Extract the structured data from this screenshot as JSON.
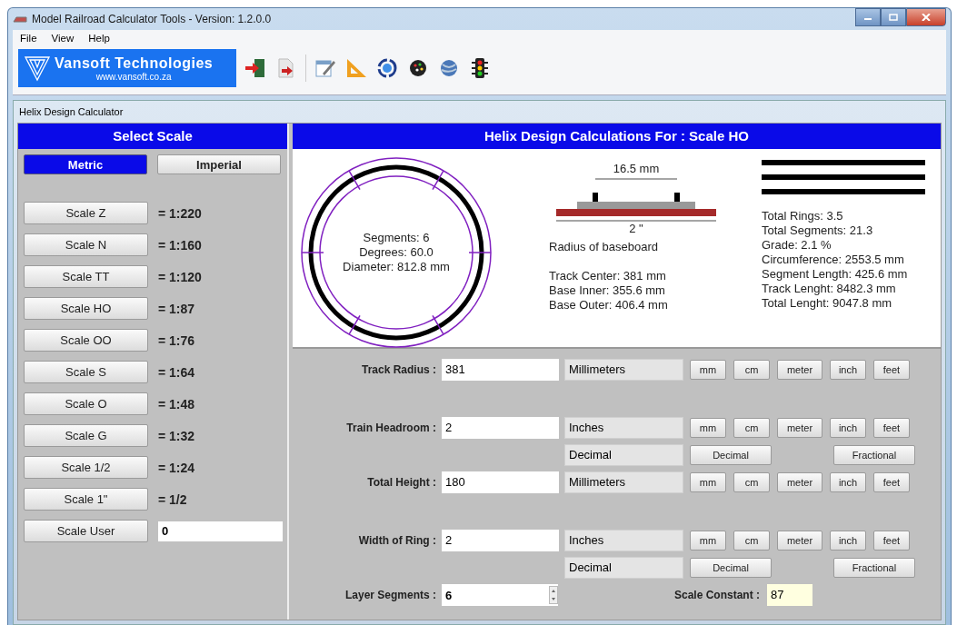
{
  "window": {
    "title": "Model Railroad Calculator Tools - Version: 1.2.0.0"
  },
  "menu": [
    {
      "label": "File"
    },
    {
      "label": "View"
    },
    {
      "label": "Help"
    }
  ],
  "toolbar": {
    "logo_title": "Vansoft Technologies",
    "logo_url": "www.vansoft.co.za"
  },
  "panel_title": "Helix Design Calculator",
  "scale_panel": {
    "title": "Select Scale",
    "systems": [
      {
        "label": "Metric",
        "selected": true
      },
      {
        "label": "Imperial",
        "selected": false
      }
    ],
    "scales": [
      {
        "label": "Scale Z",
        "ratio": "= 1:220"
      },
      {
        "label": "Scale N",
        "ratio": "= 1:160"
      },
      {
        "label": "Scale TT",
        "ratio": "= 1:120"
      },
      {
        "label": "Scale HO",
        "ratio": "= 1:87"
      },
      {
        "label": "Scale OO",
        "ratio": "= 1:76"
      },
      {
        "label": "Scale S",
        "ratio": "= 1:64"
      },
      {
        "label": "Scale O",
        "ratio": "= 1:48"
      },
      {
        "label": "Scale G",
        "ratio": "= 1:32"
      },
      {
        "label": "Scale 1/2",
        "ratio": "= 1:24"
      },
      {
        "label": "Scale 1\"",
        "ratio": "= 1/2"
      }
    ],
    "user_scale": {
      "label": "Scale User",
      "value": "0"
    }
  },
  "helix": {
    "title": "Helix Design Calculations For : Scale HO",
    "ring_info": [
      "Segments: 6",
      "Degrees: 60.0",
      "Diameter: 812.8 mm"
    ],
    "gauge": "16.5 mm",
    "headroom": "2 \"",
    "baseboard_caption": "Radius of baseboard",
    "base_info": [
      "Track Center: 381 mm",
      "Base Inner: 355.6 mm",
      "Base Outer: 406.4 mm"
    ],
    "totals": [
      "Total Rings: 3.5",
      "Total Segments: 21.3",
      "Grade: 2.1 %",
      "Circumference: 2553.5 mm",
      "Segment Length: 425.6 mm",
      "Track Lenght: 8482.3 mm",
      "Total Lenght: 9047.8 mm"
    ]
  },
  "fields": [
    {
      "label": "Track Radius :",
      "value": "381",
      "unit": "Millimeters",
      "unit_buttons": [
        "mm",
        "cm",
        "meter",
        "inch",
        "feet"
      ]
    },
    {
      "label": "Train Headroom :",
      "value": "2",
      "unit": "Inches",
      "unit_buttons": [
        "mm",
        "cm",
        "meter",
        "inch",
        "feet"
      ],
      "format": {
        "display": "Decimal",
        "buttons": [
          "Decimal",
          "Fractional"
        ]
      }
    },
    {
      "label": "Total Height :",
      "value": "180",
      "unit": "Millimeters",
      "unit_buttons": [
        "mm",
        "cm",
        "meter",
        "inch",
        "feet"
      ]
    },
    {
      "label": "Width of Ring :",
      "value": "2",
      "unit": "Inches",
      "unit_buttons": [
        "mm",
        "cm",
        "meter",
        "inch",
        "feet"
      ],
      "format": {
        "display": "Decimal",
        "buttons": [
          "Decimal",
          "Fractional"
        ]
      }
    }
  ],
  "layer_segments": {
    "label": "Layer Segments :",
    "value": "6"
  },
  "scale_constant": {
    "label": "Scale Constant :",
    "value": "87"
  }
}
